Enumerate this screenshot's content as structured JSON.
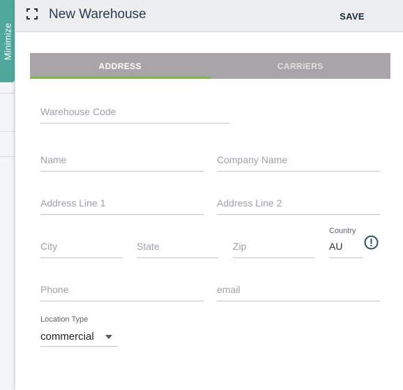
{
  "sidebar": {
    "minimize_label": "Minimize"
  },
  "header": {
    "title": "New Warehouse",
    "save_label": "SAVE"
  },
  "tabs": [
    {
      "label": "ADDRESS",
      "active": true
    },
    {
      "label": "CARRIERS",
      "active": false
    }
  ],
  "form": {
    "warehouse_code": {
      "placeholder": "Warehouse Code",
      "value": ""
    },
    "name": {
      "placeholder": "Name",
      "value": ""
    },
    "company_name": {
      "placeholder": "Company Name",
      "value": ""
    },
    "address_line_1": {
      "placeholder": "Address Line 1",
      "value": ""
    },
    "address_line_2": {
      "placeholder": "Address Line 2",
      "value": ""
    },
    "city": {
      "placeholder": "City",
      "value": ""
    },
    "state": {
      "placeholder": "State",
      "value": ""
    },
    "zip": {
      "placeholder": "Zip",
      "value": ""
    },
    "country": {
      "label": "Country",
      "value": "AU"
    },
    "phone": {
      "placeholder": "Phone",
      "value": ""
    },
    "email": {
      "placeholder": "email",
      "value": ""
    },
    "location_type": {
      "label": "Location Type",
      "value": "commercial"
    }
  },
  "icons": {
    "expand": "expand-icon",
    "info": "info-icon",
    "dropdown": "chevron-down-icon"
  },
  "colors": {
    "accent_teal": "#4fa89c",
    "tab_bar": "#a8a4a7",
    "active_tab_underline": "#7cb84a",
    "info_icon": "#2f5565"
  }
}
